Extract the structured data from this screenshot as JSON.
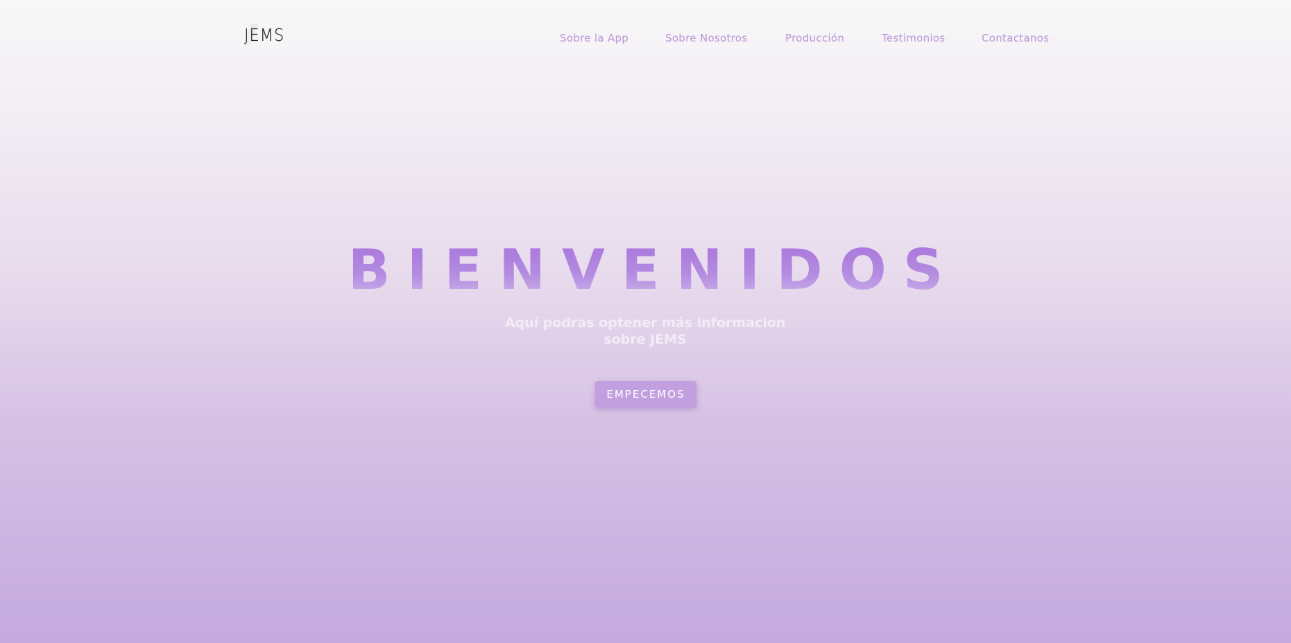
{
  "header": {
    "logo": "JEMS",
    "nav": [
      {
        "label": "Sobre la App"
      },
      {
        "label": "Sobre Nosotros"
      },
      {
        "label": "Producción"
      },
      {
        "label": "Testimonios"
      },
      {
        "label": "Contactanos"
      }
    ]
  },
  "hero": {
    "title": "BIENVENIDOS",
    "subtitle": "Aquí podras optener más informacion sobre JEMS",
    "cta_label": "EMPECEMOS"
  },
  "colors": {
    "accent": "#b995d6",
    "title": "#a871dc",
    "button": "#c29fde",
    "background_top": "#f8f8f8",
    "background_bottom": "#c5aadf"
  }
}
